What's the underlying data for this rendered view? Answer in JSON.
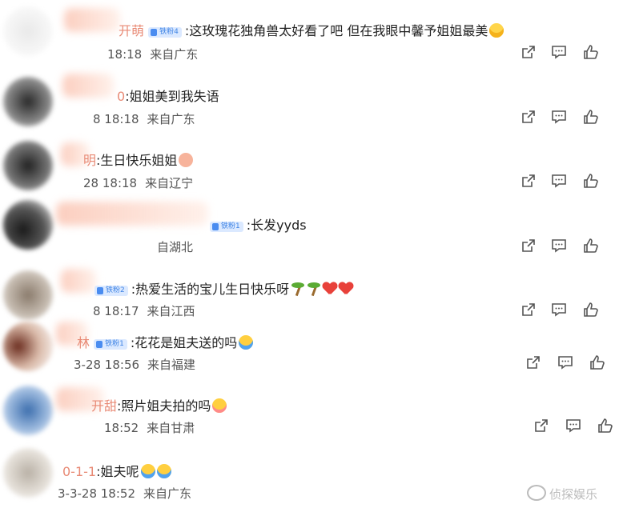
{
  "comments": [
    {
      "name_suffix": "开萌",
      "badge": "铁粉4",
      "text": ":这玫瑰花独角兽太好看了吧 但在我眼中馨予姐姐最美",
      "emoji": "sweat",
      "date_partial": "18:18",
      "location": "来自广东"
    },
    {
      "name_suffix": "0",
      "badge": "",
      "text": ":姐姐美到我失语",
      "emoji": "",
      "date_partial": "8 18:18",
      "location": "来自广东"
    },
    {
      "name_suffix": "明",
      "badge": "",
      "text": ":生日快乐姐姐",
      "emoji": "face",
      "date_partial": "28 18:18",
      "location": "来自辽宁"
    },
    {
      "name_suffix": "",
      "badge": "铁粉1",
      "text": ":长发yyds",
      "emoji": "",
      "date_partial": "",
      "location": "自湖北"
    },
    {
      "name_suffix": "",
      "badge": "铁粉2",
      "text": ":热爱生活的宝儿生日快乐呀",
      "emoji": "palm-heart",
      "date_partial": "8 18:17",
      "location": "来自江西"
    },
    {
      "name_suffix": "林",
      "badge": "铁粉1",
      "text": ":花花是姐夫送的吗",
      "emoji": "cry",
      "date_partial": "3-28 18:56",
      "location": "来自福建"
    },
    {
      "name_suffix": "开甜",
      "badge": "",
      "text": ":照片姐夫拍的吗",
      "emoji": "shy",
      "date_partial": "18:52",
      "location": "来自甘肃"
    },
    {
      "name_suffix": "0-1-1",
      "badge": "",
      "text": ":姐夫呢",
      "emoji": "cry2",
      "date_partial": "3-3-28 18:52",
      "location": "来自广东"
    }
  ],
  "actions": {
    "share": "share-icon",
    "comment": "comment-icon",
    "like": "like-icon"
  },
  "watermark": "侦探娱乐",
  "colors": {
    "badge_bg": "#dbe9ff",
    "badge_text": "#3f84e5",
    "icon": "#555555"
  }
}
